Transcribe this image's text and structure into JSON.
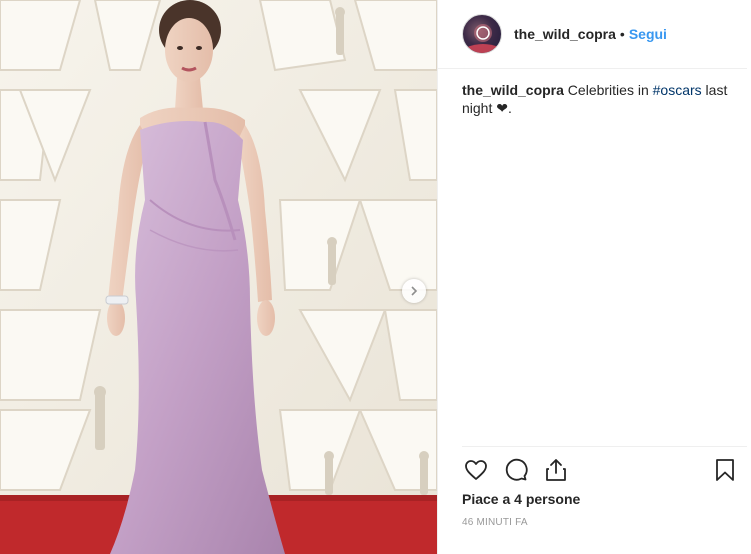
{
  "header": {
    "username": "the_wild_copra",
    "separator": "•",
    "follow_label": "Segui"
  },
  "caption": {
    "username": "the_wild_copra",
    "text_before": " Celebrities in ",
    "hashtag": "#oscars",
    "text_after": " last night ",
    "heart": "❤",
    "end": "."
  },
  "actions": {
    "icons": [
      "heart-icon",
      "comment-icon",
      "share-icon",
      "bookmark-icon"
    ]
  },
  "likes": {
    "text": "Piace a 4 persone"
  },
  "timestamp": {
    "text": "46 MINUTI FA"
  },
  "colors": {
    "follow": "#3897f0",
    "hashtag": "#003569",
    "carpet": "#c0292c",
    "dress": "#c8a7cc"
  }
}
